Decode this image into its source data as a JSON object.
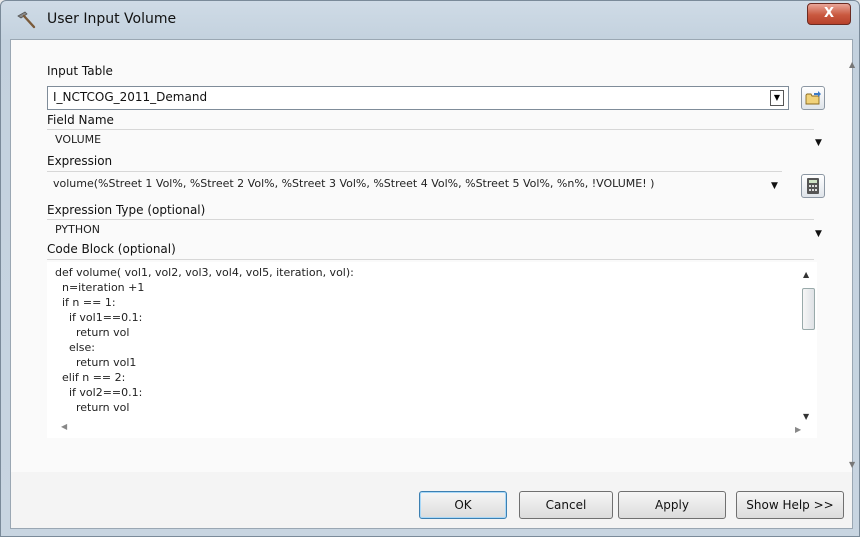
{
  "window": {
    "title": "User Input Volume",
    "close_label": "X"
  },
  "input_table": {
    "label": "Input Table",
    "value": "I_NCTCOG_2011_Demand"
  },
  "field_name": {
    "label": "Field Name",
    "value": "VOLUME"
  },
  "expression": {
    "label": "Expression",
    "value": "volume(%Street 1 Vol%, %Street 2 Vol%, %Street 3 Vol%, %Street 4 Vol%, %Street 5 Vol%, %n%, !VOLUME! )"
  },
  "expression_type": {
    "label": "Expression Type (optional)",
    "value": "PYTHON"
  },
  "code_block": {
    "label": "Code Block (optional)",
    "lines": [
      "def volume( vol1, vol2, vol3, vol4, vol5, iteration, vol):",
      "  n=iteration +1",
      "  if n == 1:",
      "    if vol1==0.1:",
      "      return vol",
      "    else:",
      "      return vol1",
      "  elif n == 2:",
      "    if vol2==0.1:",
      "      return vol"
    ]
  },
  "buttons": {
    "ok": "OK",
    "cancel": "Cancel",
    "apply": "Apply",
    "show_help": "Show Help >>"
  },
  "icons": {
    "title": "hammer-icon",
    "browse": "open-folder-icon",
    "calculator": "calculator-icon"
  }
}
